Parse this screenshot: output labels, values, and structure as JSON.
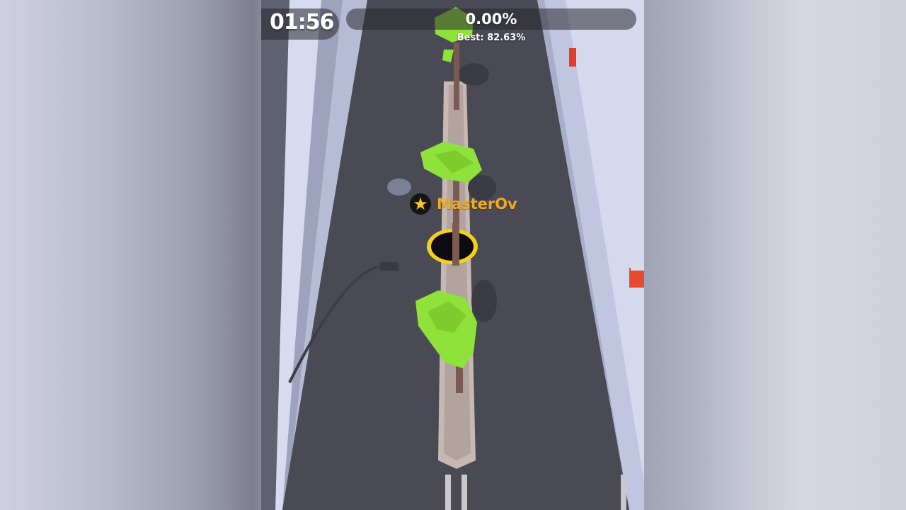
{
  "hud": {
    "timer": "01:56",
    "progress_text": "0.00%",
    "progress_fraction": 0.0,
    "best_text": "Best: 82.63%"
  },
  "player": {
    "name": "MasterOv",
    "badge_icon": "star-icon"
  },
  "colors": {
    "road": "#4a4a55",
    "sidewalk": "#c3c9e4",
    "tree": "#8fe23a",
    "hole_ring": "#f3d01a",
    "player_name": "#f2a91c"
  }
}
